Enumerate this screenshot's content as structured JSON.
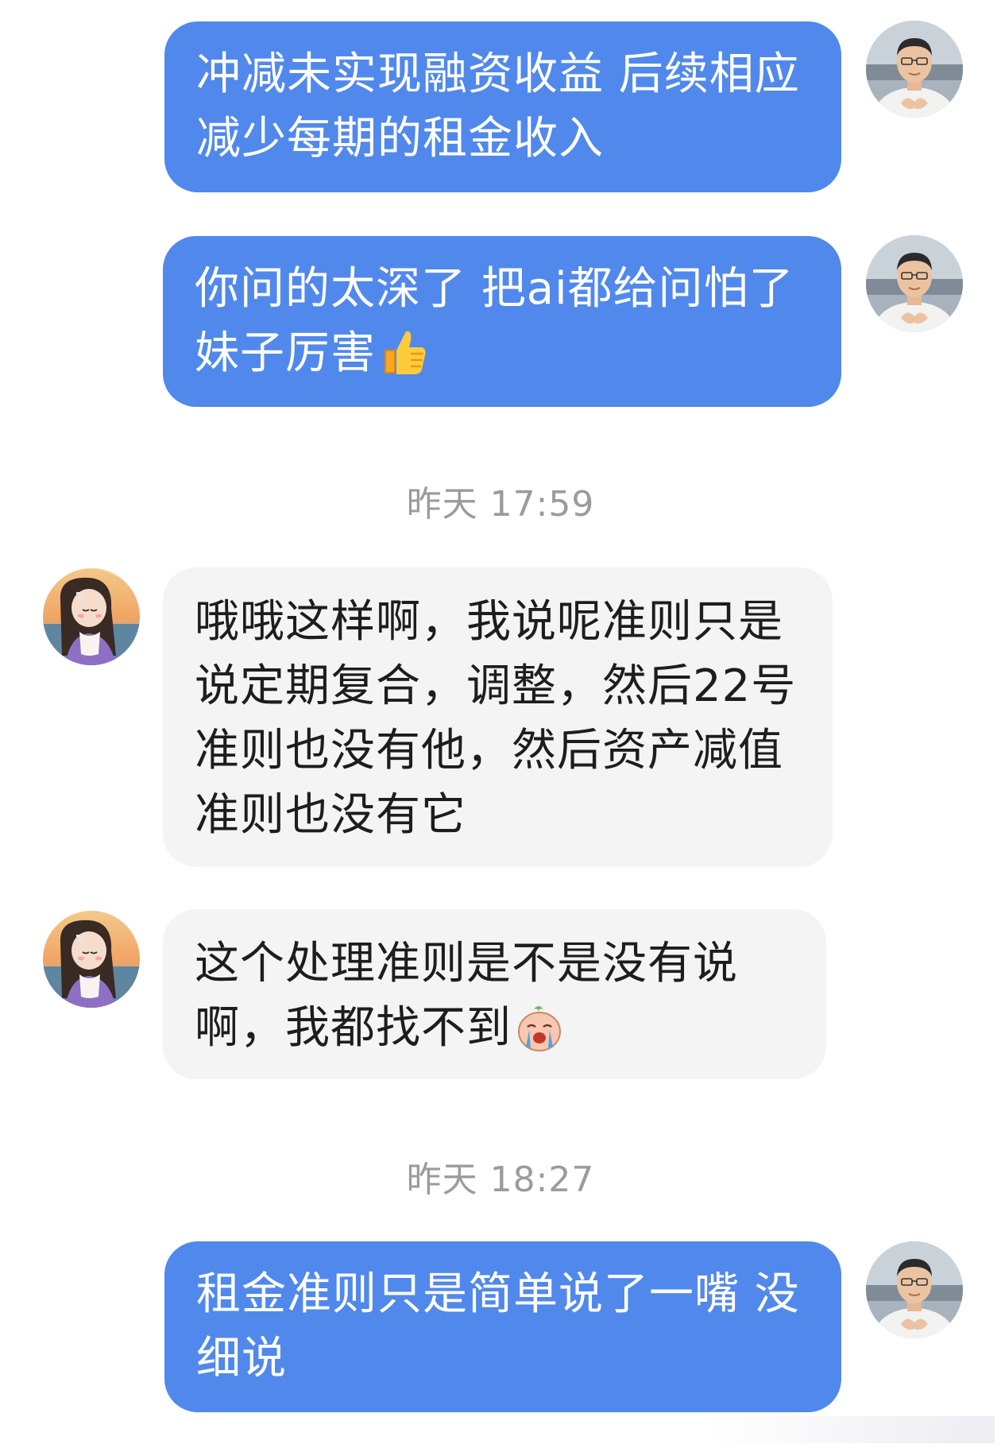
{
  "messages": [
    {
      "side": "out",
      "text": "冲减未实现融资收益 后续相应减少每期的租金收入"
    },
    {
      "side": "out",
      "text": "你问的太深了 把ai都给问怕了 妹子厉害",
      "emoji": "thumbs-up-icon"
    },
    {
      "side": "in",
      "text": "哦哦这样啊，我说呢准则只是说定期复合，调整，然后22号准则也没有他，然后资产减值准则也没有它"
    },
    {
      "side": "in",
      "text": "这个处理准则是不是没有说啊，我都找不到",
      "emoji": "crying-face-icon"
    },
    {
      "side": "out",
      "text": "租金准则只是简单说了一嘴 没细说"
    }
  ],
  "timestamps": [
    "昨天 17:59",
    "昨天 18:27"
  ],
  "colors": {
    "outgoing_bubble": "#5188ec",
    "incoming_bubble": "#f4f4f4",
    "timestamp_text": "#9b9b9b"
  }
}
